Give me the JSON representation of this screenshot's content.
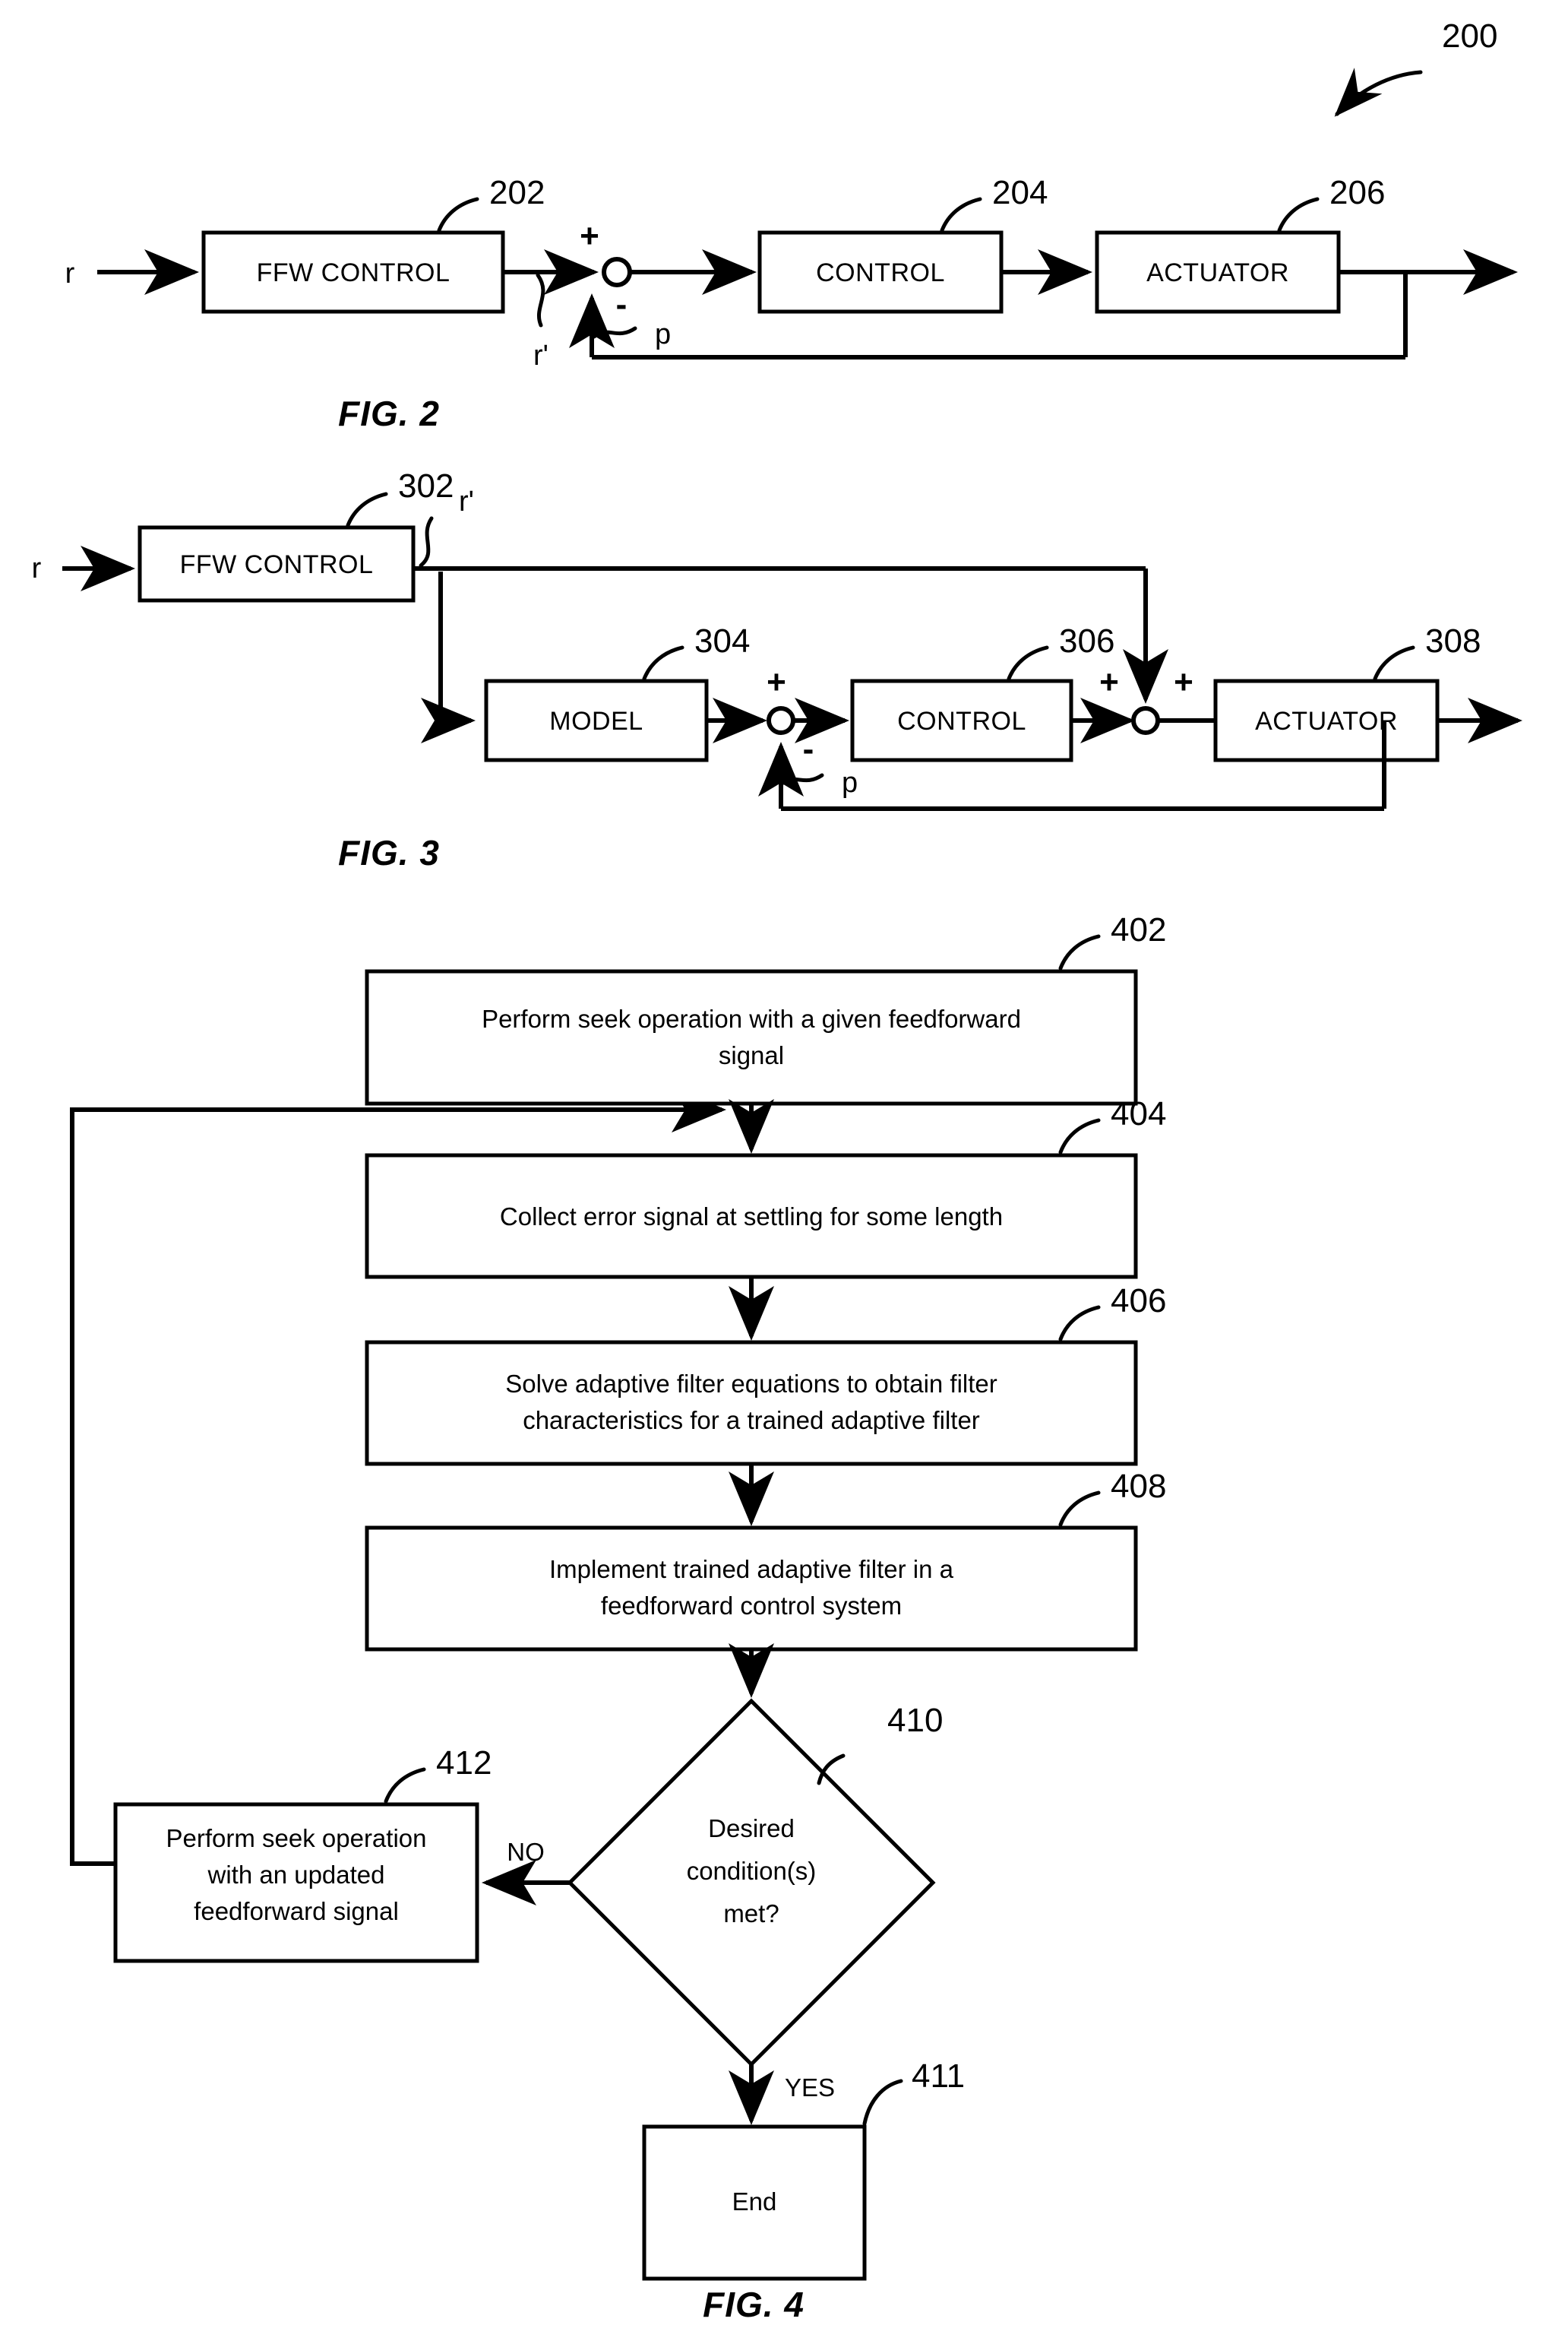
{
  "document": {
    "type": "patent-figure-sheet",
    "figures": [
      "FIG. 2",
      "FIG. 3",
      "FIG. 4"
    ]
  },
  "fig2": {
    "caption": "FIG. 2",
    "system_ref": "200",
    "input_label": "r",
    "blocks": [
      {
        "label": "FFW CONTROL",
        "ref": "202"
      },
      {
        "label": "CONTROL",
        "ref": "204"
      },
      {
        "label": "ACTUATOR",
        "ref": "206"
      }
    ],
    "signals": {
      "r_prime": "r'",
      "p": "p"
    },
    "summing_signs": {
      "plus": "+",
      "minus": "-"
    }
  },
  "fig3": {
    "caption": "FIG. 3",
    "input_label": "r",
    "blocks": [
      {
        "label": "FFW CONTROL",
        "ref": "302"
      },
      {
        "label": "MODEL",
        "ref": "304"
      },
      {
        "label": "CONTROL",
        "ref": "306"
      },
      {
        "label": "ACTUATOR",
        "ref": "308"
      }
    ],
    "signals": {
      "r_prime": "r'",
      "p": "p"
    },
    "summing_signs": {
      "plus": "+",
      "minus": "-",
      "plus_left": "+",
      "plus_right": "+"
    }
  },
  "fig4": {
    "caption": "FIG. 4",
    "steps": [
      {
        "ref": "402",
        "shape": "process",
        "lines": [
          "Perform seek operation with a given feedforward",
          "signal"
        ]
      },
      {
        "ref": "404",
        "shape": "process",
        "lines": [
          "Collect error signal at settling for some length"
        ]
      },
      {
        "ref": "406",
        "shape": "process",
        "lines": [
          "Solve adaptive filter equations to obtain filter",
          "characteristics for a trained adaptive filter"
        ]
      },
      {
        "ref": "408",
        "shape": "process",
        "lines": [
          "Implement trained adaptive filter in a",
          "feedforward control system"
        ]
      },
      {
        "ref": "410",
        "shape": "decision",
        "lines": [
          "Desired",
          "condition(s)",
          "met?"
        ]
      },
      {
        "ref": "412",
        "shape": "process",
        "lines": [
          "Perform seek operation",
          "with an updated",
          "feedforward signal"
        ]
      },
      {
        "ref": "411",
        "shape": "terminator",
        "lines": [
          "End"
        ]
      }
    ],
    "branch_labels": {
      "no": "NO",
      "yes": "YES"
    }
  }
}
